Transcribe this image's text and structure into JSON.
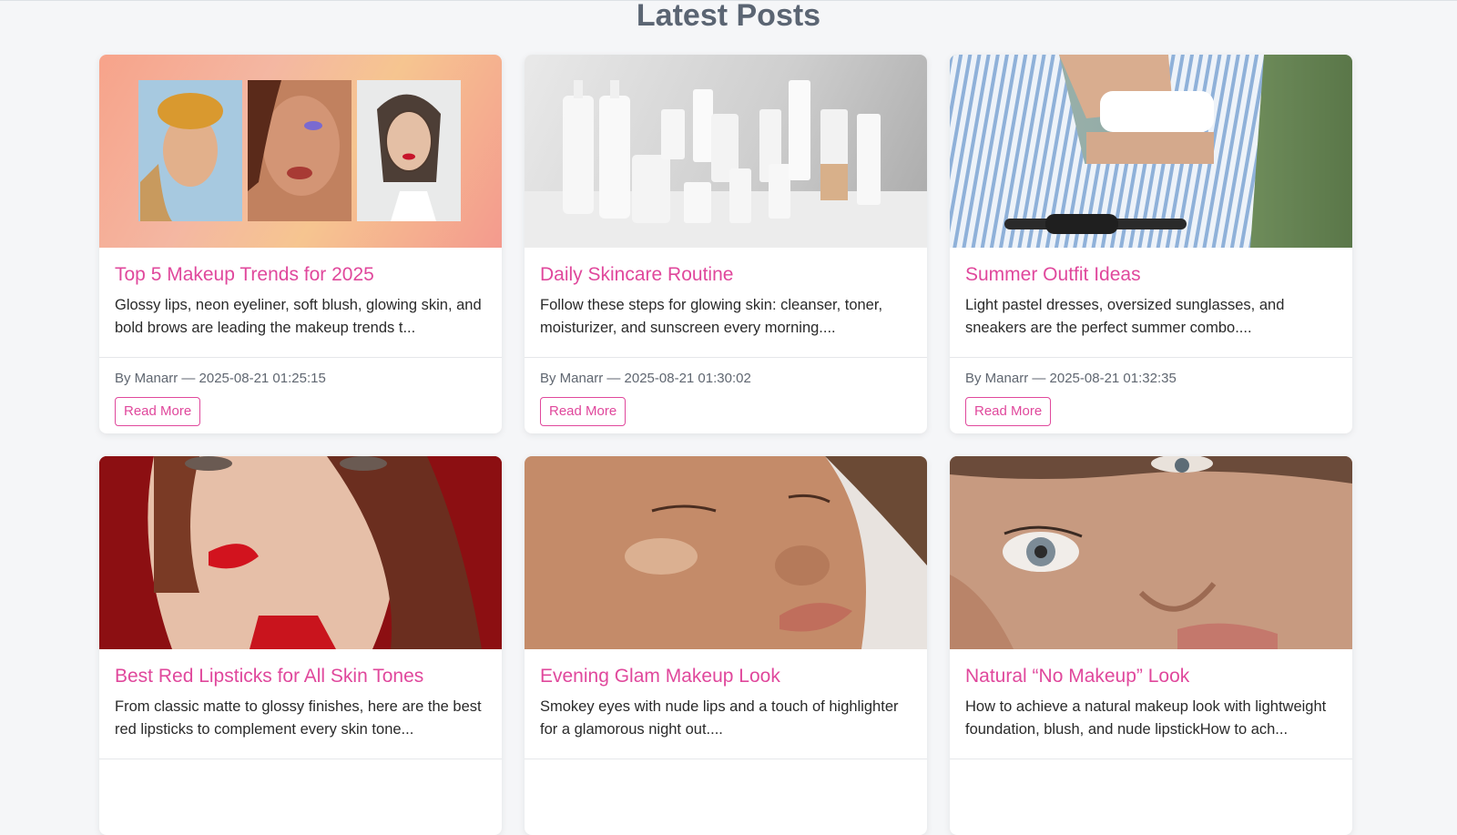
{
  "page": {
    "title": "Latest Posts"
  },
  "colors": {
    "accent": "#e0489c",
    "background": "#f5f6f8",
    "title_gray": "#5b6573"
  },
  "posts": [
    {
      "title": "Top 5 Makeup Trends for 2025",
      "excerpt": "Glossy lips, neon eyeliner, soft blush, glowing skin, and bold brows are leading the makeup trends t...",
      "meta": "By Manarr — 2025-08-21 01:25:15",
      "button": "Read More"
    },
    {
      "title": "Daily Skincare Routine",
      "excerpt": "Follow these steps for glowing skin: cleanser, toner, moisturizer, and sunscreen every morning....",
      "meta": "By Manarr — 2025-08-21 01:30:02",
      "button": "Read More"
    },
    {
      "title": "Summer Outfit Ideas",
      "excerpt": "Light pastel dresses, oversized sunglasses, and sneakers are the perfect summer combo....",
      "meta": "By Manarr — 2025-08-21 01:32:35",
      "button": "Read More"
    },
    {
      "title": "Best Red Lipsticks for All Skin Tones",
      "excerpt": "From classic matte to glossy finishes, here are the best red lipsticks to complement every skin tone...",
      "meta": "",
      "button": ""
    },
    {
      "title": "Evening Glam Makeup Look",
      "excerpt": "Smokey eyes with nude lips and a touch of highlighter for a glamorous night out....",
      "meta": "",
      "button": ""
    },
    {
      "title": "Natural “No Makeup” Look",
      "excerpt": "How to achieve a natural makeup look with lightweight foundation, blush, and nude lipstickHow to ach...",
      "meta": "",
      "button": ""
    }
  ]
}
